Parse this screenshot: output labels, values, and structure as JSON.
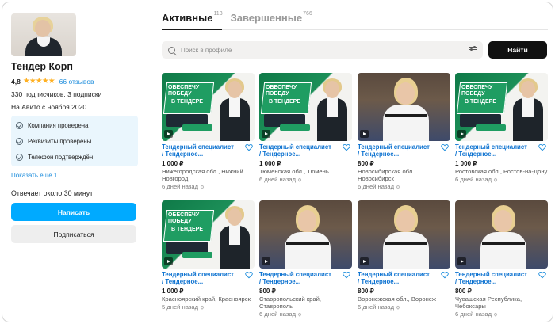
{
  "profile": {
    "name": "Тендер Корп",
    "rating": "4,8",
    "stars": "★★★★★",
    "reviews": "66 отзывов",
    "subscribers": "330 подписчиков, 3 подписки",
    "since": "На Авито с ноября 2020",
    "verifications": [
      "Компания проверена",
      "Реквизиты проверены",
      "Телефон подтверждён"
    ],
    "show_more": "Показать ещё 1",
    "reply_time": "Отвечает около 30 минут",
    "write_button": "Написать",
    "subscribe_button": "Подписаться"
  },
  "tabs": [
    {
      "label": "Активные",
      "count": "113"
    },
    {
      "label": "Завершенные",
      "count": "766"
    }
  ],
  "search": {
    "placeholder": "Поиск в профиле",
    "value": "",
    "find_button": "Найти"
  },
  "accent": "#00aaff",
  "listings": [
    {
      "kind": "promo",
      "title": "Тендерный специалист\n/ Тендерное...",
      "price": "1 000 ₽",
      "location": "Нижегородская обл., Нижний Новгород",
      "age": "6 дней назад"
    },
    {
      "kind": "promo",
      "title": "Тендерный специалист\n/ Тендерное...",
      "price": "1 000 ₽",
      "location": "Тюменская обл., Тюмень",
      "age": "6 дней назад"
    },
    {
      "kind": "photo",
      "title": "Тендерный специалист\n/ Тендерное...",
      "price": "800 ₽",
      "location": "Новосибирская обл., Новосибирск",
      "age": "6 дней назад"
    },
    {
      "kind": "promo",
      "title": "Тендерный специалист\n/ Тендерное...",
      "price": "1 000 ₽",
      "location": "Ростовская обл., Ростов-на-Дону",
      "age": "6 дней назад"
    },
    {
      "kind": "promo",
      "title": "Тендерный специалист\n/ Тендерное...",
      "price": "1 000 ₽",
      "location": "Красноярский край, Красноярск",
      "age": "5 дней назад"
    },
    {
      "kind": "photo",
      "title": "Тендерный специалист\n/ Тендерное...",
      "price": "800 ₽",
      "location": "Ставропольский край, Ставрополь",
      "age": "6 дней назад"
    },
    {
      "kind": "photo",
      "title": "Тендерный специалист\n/ Тендерное...",
      "price": "800 ₽",
      "location": "Воронежская обл., Воронеж",
      "age": "6 дней назад"
    },
    {
      "kind": "photo",
      "title": "Тендерный специалист\n/ Тендерное...",
      "price": "800 ₽",
      "location": "Чувашская Республика, Чебоксары",
      "age": "6 дней назад"
    }
  ],
  "promo_banner": {
    "headline": "ОБЕСПЕЧУ ПОБЕДУ",
    "subline": "В ТЕНДЕРЕ"
  }
}
